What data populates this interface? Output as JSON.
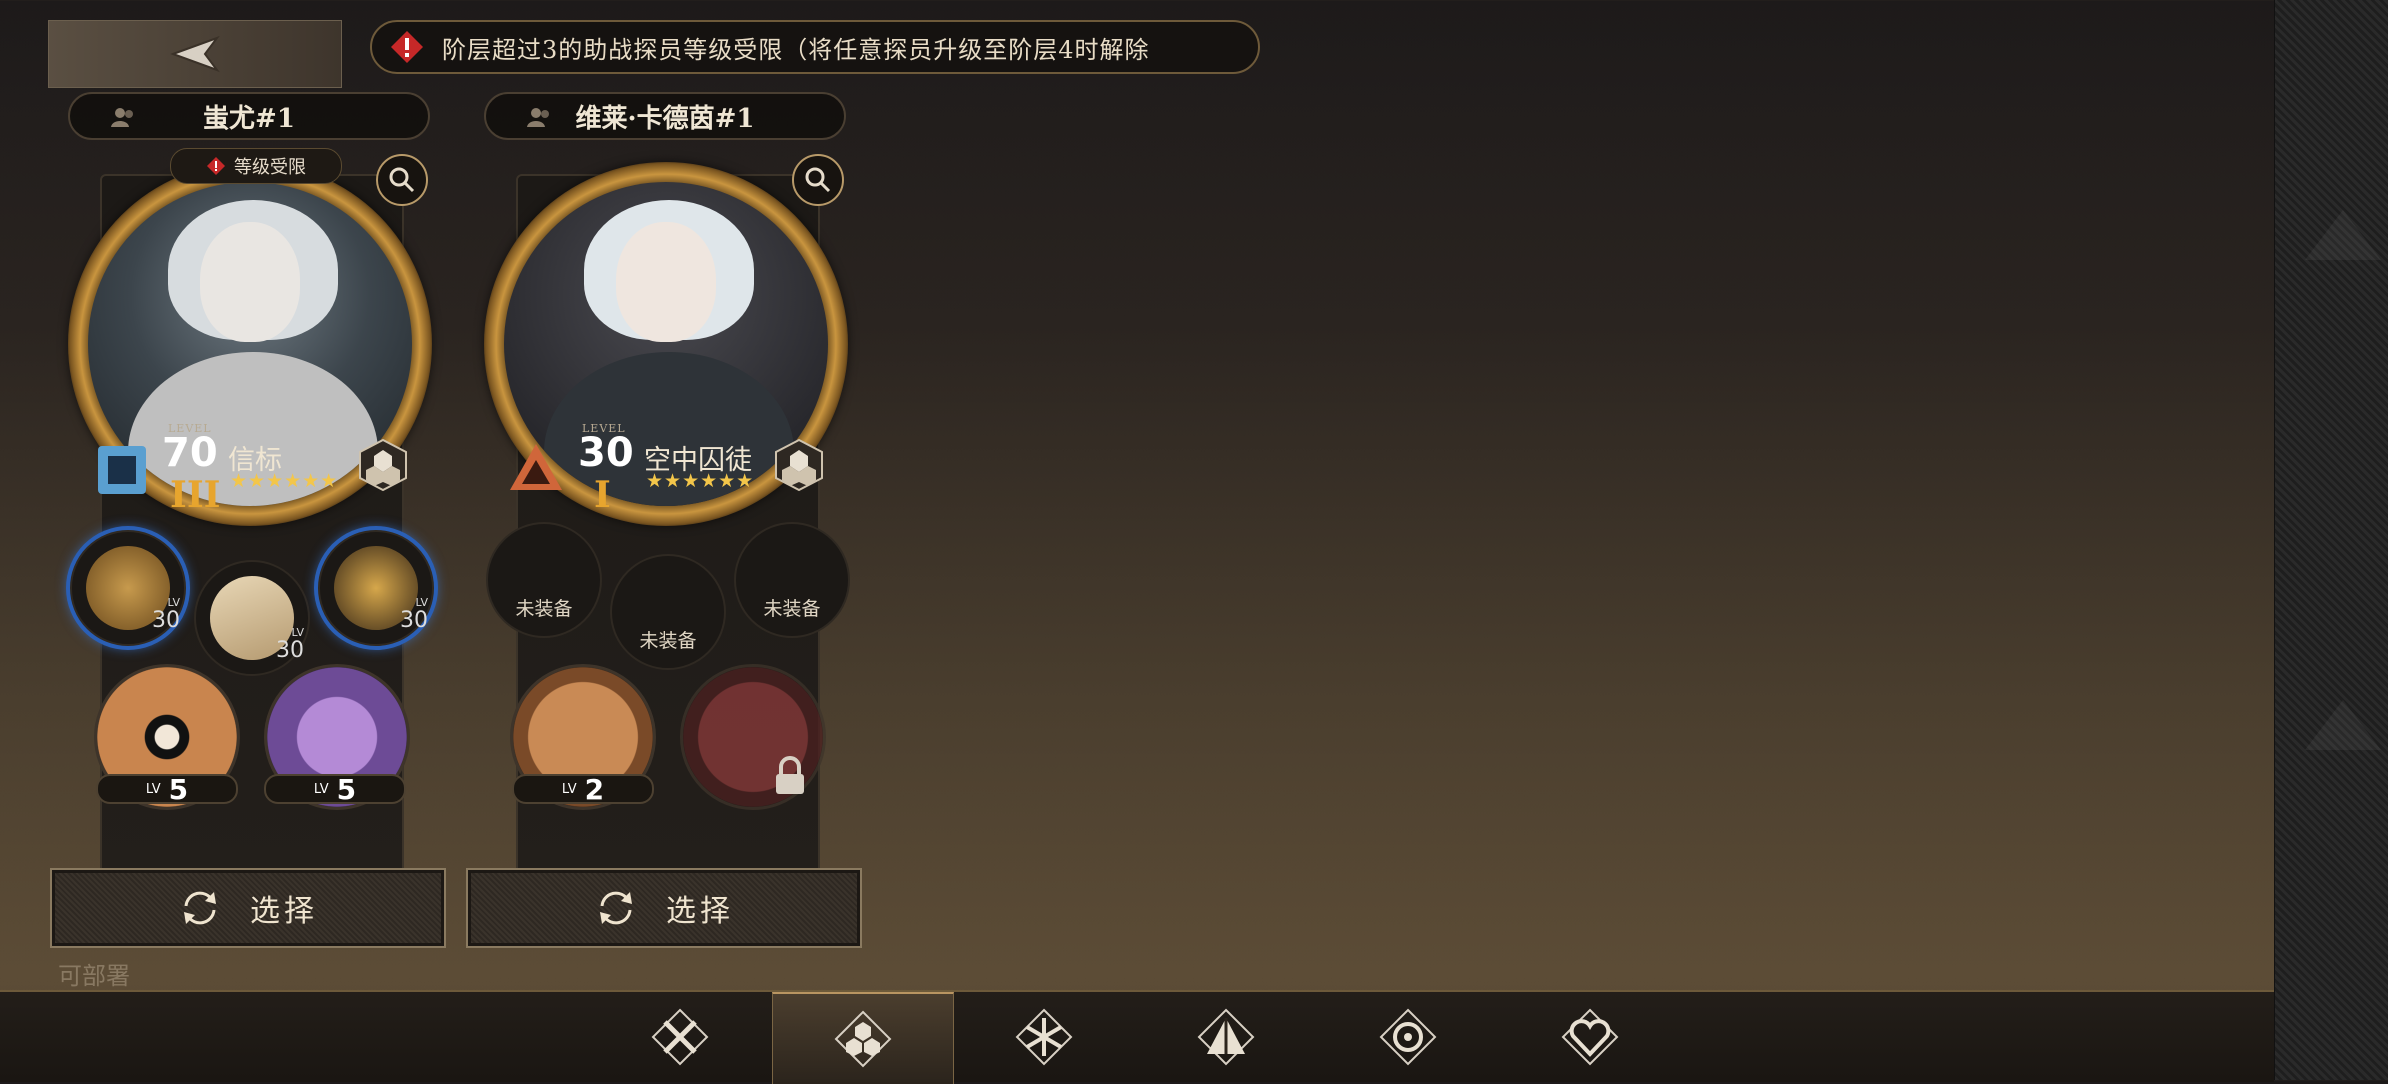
{
  "warning": {
    "text": "阶层超过3的助战探员等级受限（将任意探员升级至阶层4时解除"
  },
  "cards": [
    {
      "name": "蚩尤#1",
      "limit_badge": "等级受限",
      "level_label": "LEVEL",
      "level": "70",
      "class_name": "信标",
      "stars": "★★★★★★",
      "rank": "III",
      "gear": [
        {
          "lv_label": "LV",
          "lv": "30"
        },
        {
          "lv_label": "LV",
          "lv": "30"
        },
        {
          "lv_label": "LV",
          "lv": "30"
        }
      ],
      "skills": [
        {
          "lv_label": "LV",
          "lv": "5"
        },
        {
          "lv_label": "LV",
          "lv": "5"
        }
      ],
      "select_label": "选择"
    },
    {
      "name": "维莱·卡德茵#1",
      "level_label": "LEVEL",
      "level": "30",
      "class_name": "空中囚徒",
      "stars": "★★★★★★",
      "rank": "I",
      "gear": [
        {
          "empty": "未装备"
        },
        {
          "empty": "未装备"
        },
        {
          "empty": "未装备"
        }
      ],
      "skills": [
        {
          "lv_label": "LV",
          "lv": "2"
        }
      ],
      "select_label": "选择"
    }
  ],
  "footer_text": "可部署",
  "nav_tabs": [
    "swords-icon",
    "hexagon-cluster-icon",
    "snowflake-icon",
    "pyramid-icon",
    "target-icon",
    "heart-icon"
  ],
  "colors": {
    "accent_gold": "#c9953f",
    "warning_red": "#c62828",
    "rank_orange": "#e7a52e",
    "gear_blue": "#2a5fb5"
  }
}
